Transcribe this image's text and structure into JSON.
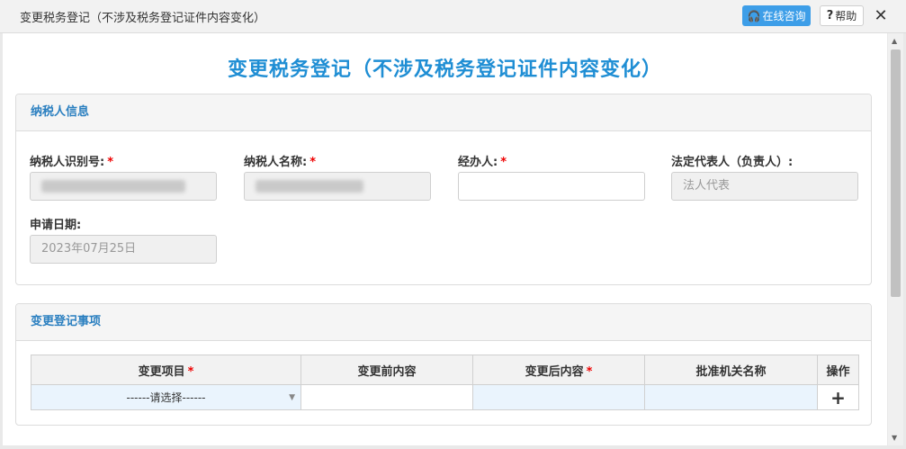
{
  "window": {
    "title": "变更税务登记（不涉及税务登记证件内容变化）",
    "consult_label": "在线咨询",
    "help_label": "帮助",
    "close_label": "✕"
  },
  "page": {
    "title": "变更税务登记（不涉及税务登记证件内容变化）"
  },
  "taxpayer_panel": {
    "heading": "纳税人信息",
    "taxpayer_id_label": "纳税人识别号:",
    "taxpayer_name_label": "纳税人名称:",
    "handler_label": "经办人:",
    "legal_rep_label": "法定代表人（负责人）:",
    "legal_rep_placeholder": "法人代表",
    "apply_date_label": "申请日期:",
    "apply_date_value": "2023年07月25日",
    "handler_value": "",
    "required_mark": "*"
  },
  "change_panel": {
    "heading": "变更登记事项",
    "columns": [
      "变更项目",
      "变更前内容",
      "变更后内容",
      "批准机关名称",
      "操作"
    ],
    "row": {
      "select_value": "------请选择------",
      "add_icon": "plus-icon",
      "add_label": "+"
    }
  },
  "colors": {
    "accent": "#1f8ed4",
    "panel_heading": "#2a7fc0",
    "required": "#e00000",
    "consult_button": "#3d9ee8"
  }
}
